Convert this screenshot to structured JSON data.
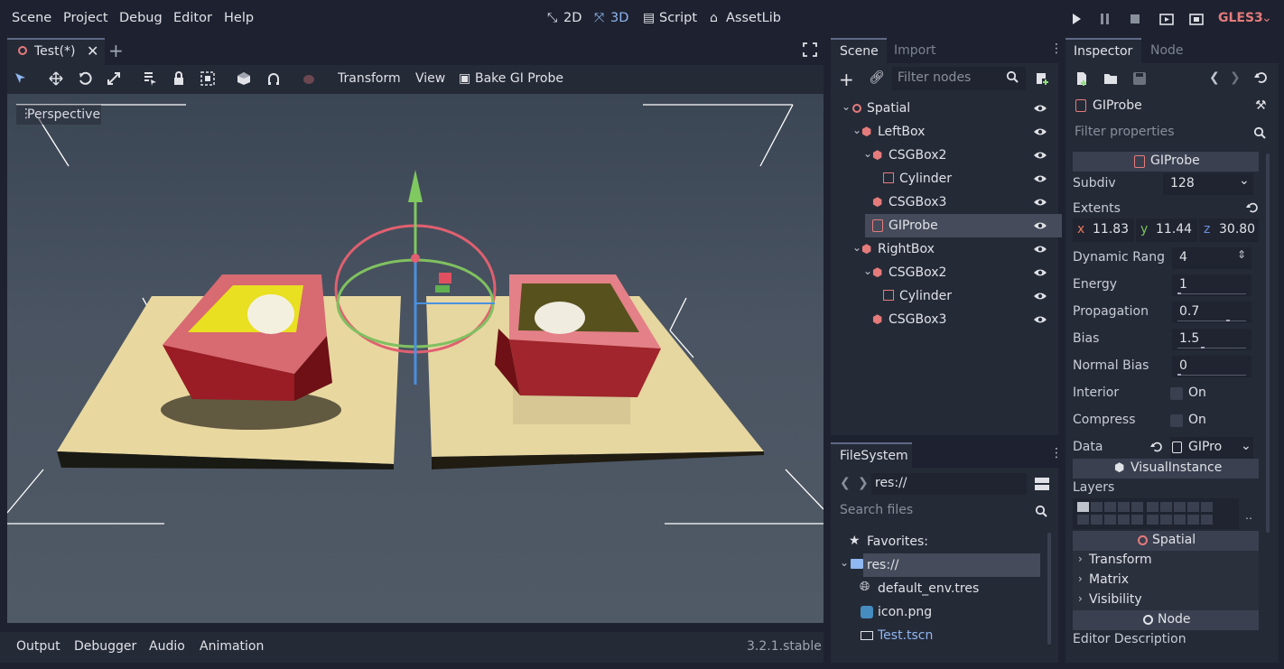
{
  "menu": {
    "scene": "Scene",
    "project": "Project",
    "debug": "Debug",
    "editor": "Editor",
    "help": "Help"
  },
  "modes": {
    "m2d": "2D",
    "m3d": "3D",
    "script": "Script",
    "assetlib": "AssetLib"
  },
  "renderer": "GLES3",
  "scene_tab": {
    "title": "Test(*)"
  },
  "viewport_toolbar": {
    "transform": "Transform",
    "view": "View",
    "bake": "Bake GI Probe"
  },
  "viewport": {
    "label": "Perspective"
  },
  "scene_dock": {
    "tab_scene": "Scene",
    "tab_import": "Import",
    "filter_placeholder": "Filter nodes",
    "nodes": [
      {
        "label": "Spatial"
      },
      {
        "label": "LeftBox"
      },
      {
        "label": "CSGBox2"
      },
      {
        "label": "Cylinder"
      },
      {
        "label": "CSGBox3"
      },
      {
        "label": "GIProbe"
      },
      {
        "label": "RightBox"
      },
      {
        "label": "CSGBox2"
      },
      {
        "label": "Cylinder"
      },
      {
        "label": "CSGBox3"
      }
    ]
  },
  "filesystem": {
    "tab": "FileSystem",
    "path": "res://",
    "search_placeholder": "Search files",
    "favorites": "Favorites:",
    "root": "res://",
    "files": [
      {
        "label": "default_env.tres"
      },
      {
        "label": "icon.png"
      },
      {
        "label": "Test.tscn"
      }
    ]
  },
  "bottom": {
    "output": "Output",
    "debugger": "Debugger",
    "audio": "Audio",
    "animation": "Animation",
    "version": "3.2.1.stable"
  },
  "inspector": {
    "tab_inspector": "Inspector",
    "tab_node": "Node",
    "object": "GIProbe",
    "filter_placeholder": "Filter properties",
    "section_giprobe": "GIProbe",
    "subdiv_label": "Subdiv",
    "subdiv_value": "128",
    "extents_label": "Extents",
    "ext_x_label": "x",
    "ext_x": "11.83",
    "ext_y_label": "y",
    "ext_y": "11.44",
    "ext_z_label": "z",
    "ext_z": "30.80",
    "dynrange_label": "Dynamic Rang",
    "dynrange_value": "4",
    "energy_label": "Energy",
    "energy_value": "1",
    "propagation_label": "Propagation",
    "propagation_value": "0.7",
    "bias_label": "Bias",
    "bias_value": "1.5",
    "normalbias_label": "Normal Bias",
    "normalbias_value": "0",
    "interior_label": "Interior",
    "interior_value": "On",
    "compress_label": "Compress",
    "compress_value": "On",
    "data_label": "Data",
    "data_value": "GIPro",
    "section_visual": "VisualInstance",
    "layers_label": "Layers",
    "section_spatial": "Spatial",
    "transform": "Transform",
    "matrix": "Matrix",
    "visibility": "Visibility",
    "section_node": "Node",
    "editor_desc": "Editor Description"
  },
  "colors": {
    "accent": "#8fb7f0",
    "renderer": "#e57b7b",
    "bg": "#1e2230",
    "panel": "#252a37"
  }
}
